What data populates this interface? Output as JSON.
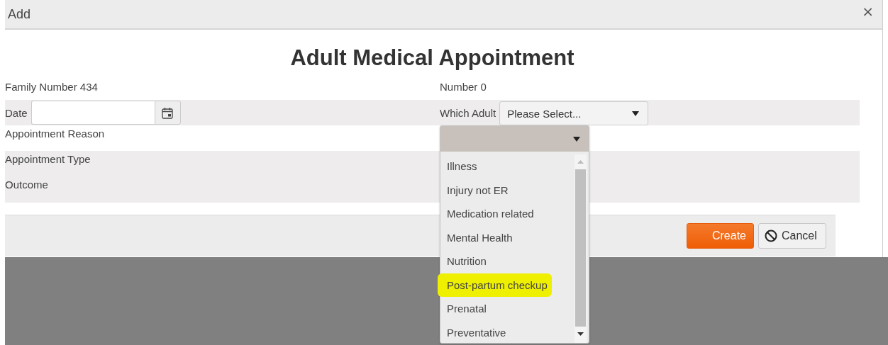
{
  "dialog": {
    "title": "Add",
    "close": "×",
    "heading": "Adult Medical Appointment"
  },
  "rows": [
    {
      "left": {
        "kind": "text",
        "label": "Family Number 434"
      },
      "right": {
        "kind": "text",
        "label": "Number 0"
      }
    },
    {
      "left": {
        "kind": "date",
        "label": "Date"
      },
      "right": {
        "kind": "select",
        "label": "Which Adult",
        "value": "Please Select..."
      }
    },
    {
      "left": {
        "kind": "text",
        "label": "Appointment Reason"
      }
    },
    {
      "left": {
        "kind": "text",
        "label": "Appointment Type"
      }
    },
    {
      "left": {
        "kind": "text",
        "label": "Outcome"
      }
    }
  ],
  "dropdown": {
    "items": [
      {
        "label": "Illness",
        "highlighted": false
      },
      {
        "label": "Injury not ER",
        "highlighted": false
      },
      {
        "label": "Medication related",
        "highlighted": false
      },
      {
        "label": "Mental Health",
        "highlighted": false
      },
      {
        "label": "Nutrition",
        "highlighted": false
      },
      {
        "label": "Post-partum checkup",
        "highlighted": true
      },
      {
        "label": "Prenatal",
        "highlighted": false
      },
      {
        "label": "Preventative",
        "highlighted": false
      }
    ]
  },
  "buttons": [
    {
      "kind": "primary",
      "label": "Create"
    },
    {
      "kind": "cancel",
      "label": "Cancel"
    }
  ]
}
